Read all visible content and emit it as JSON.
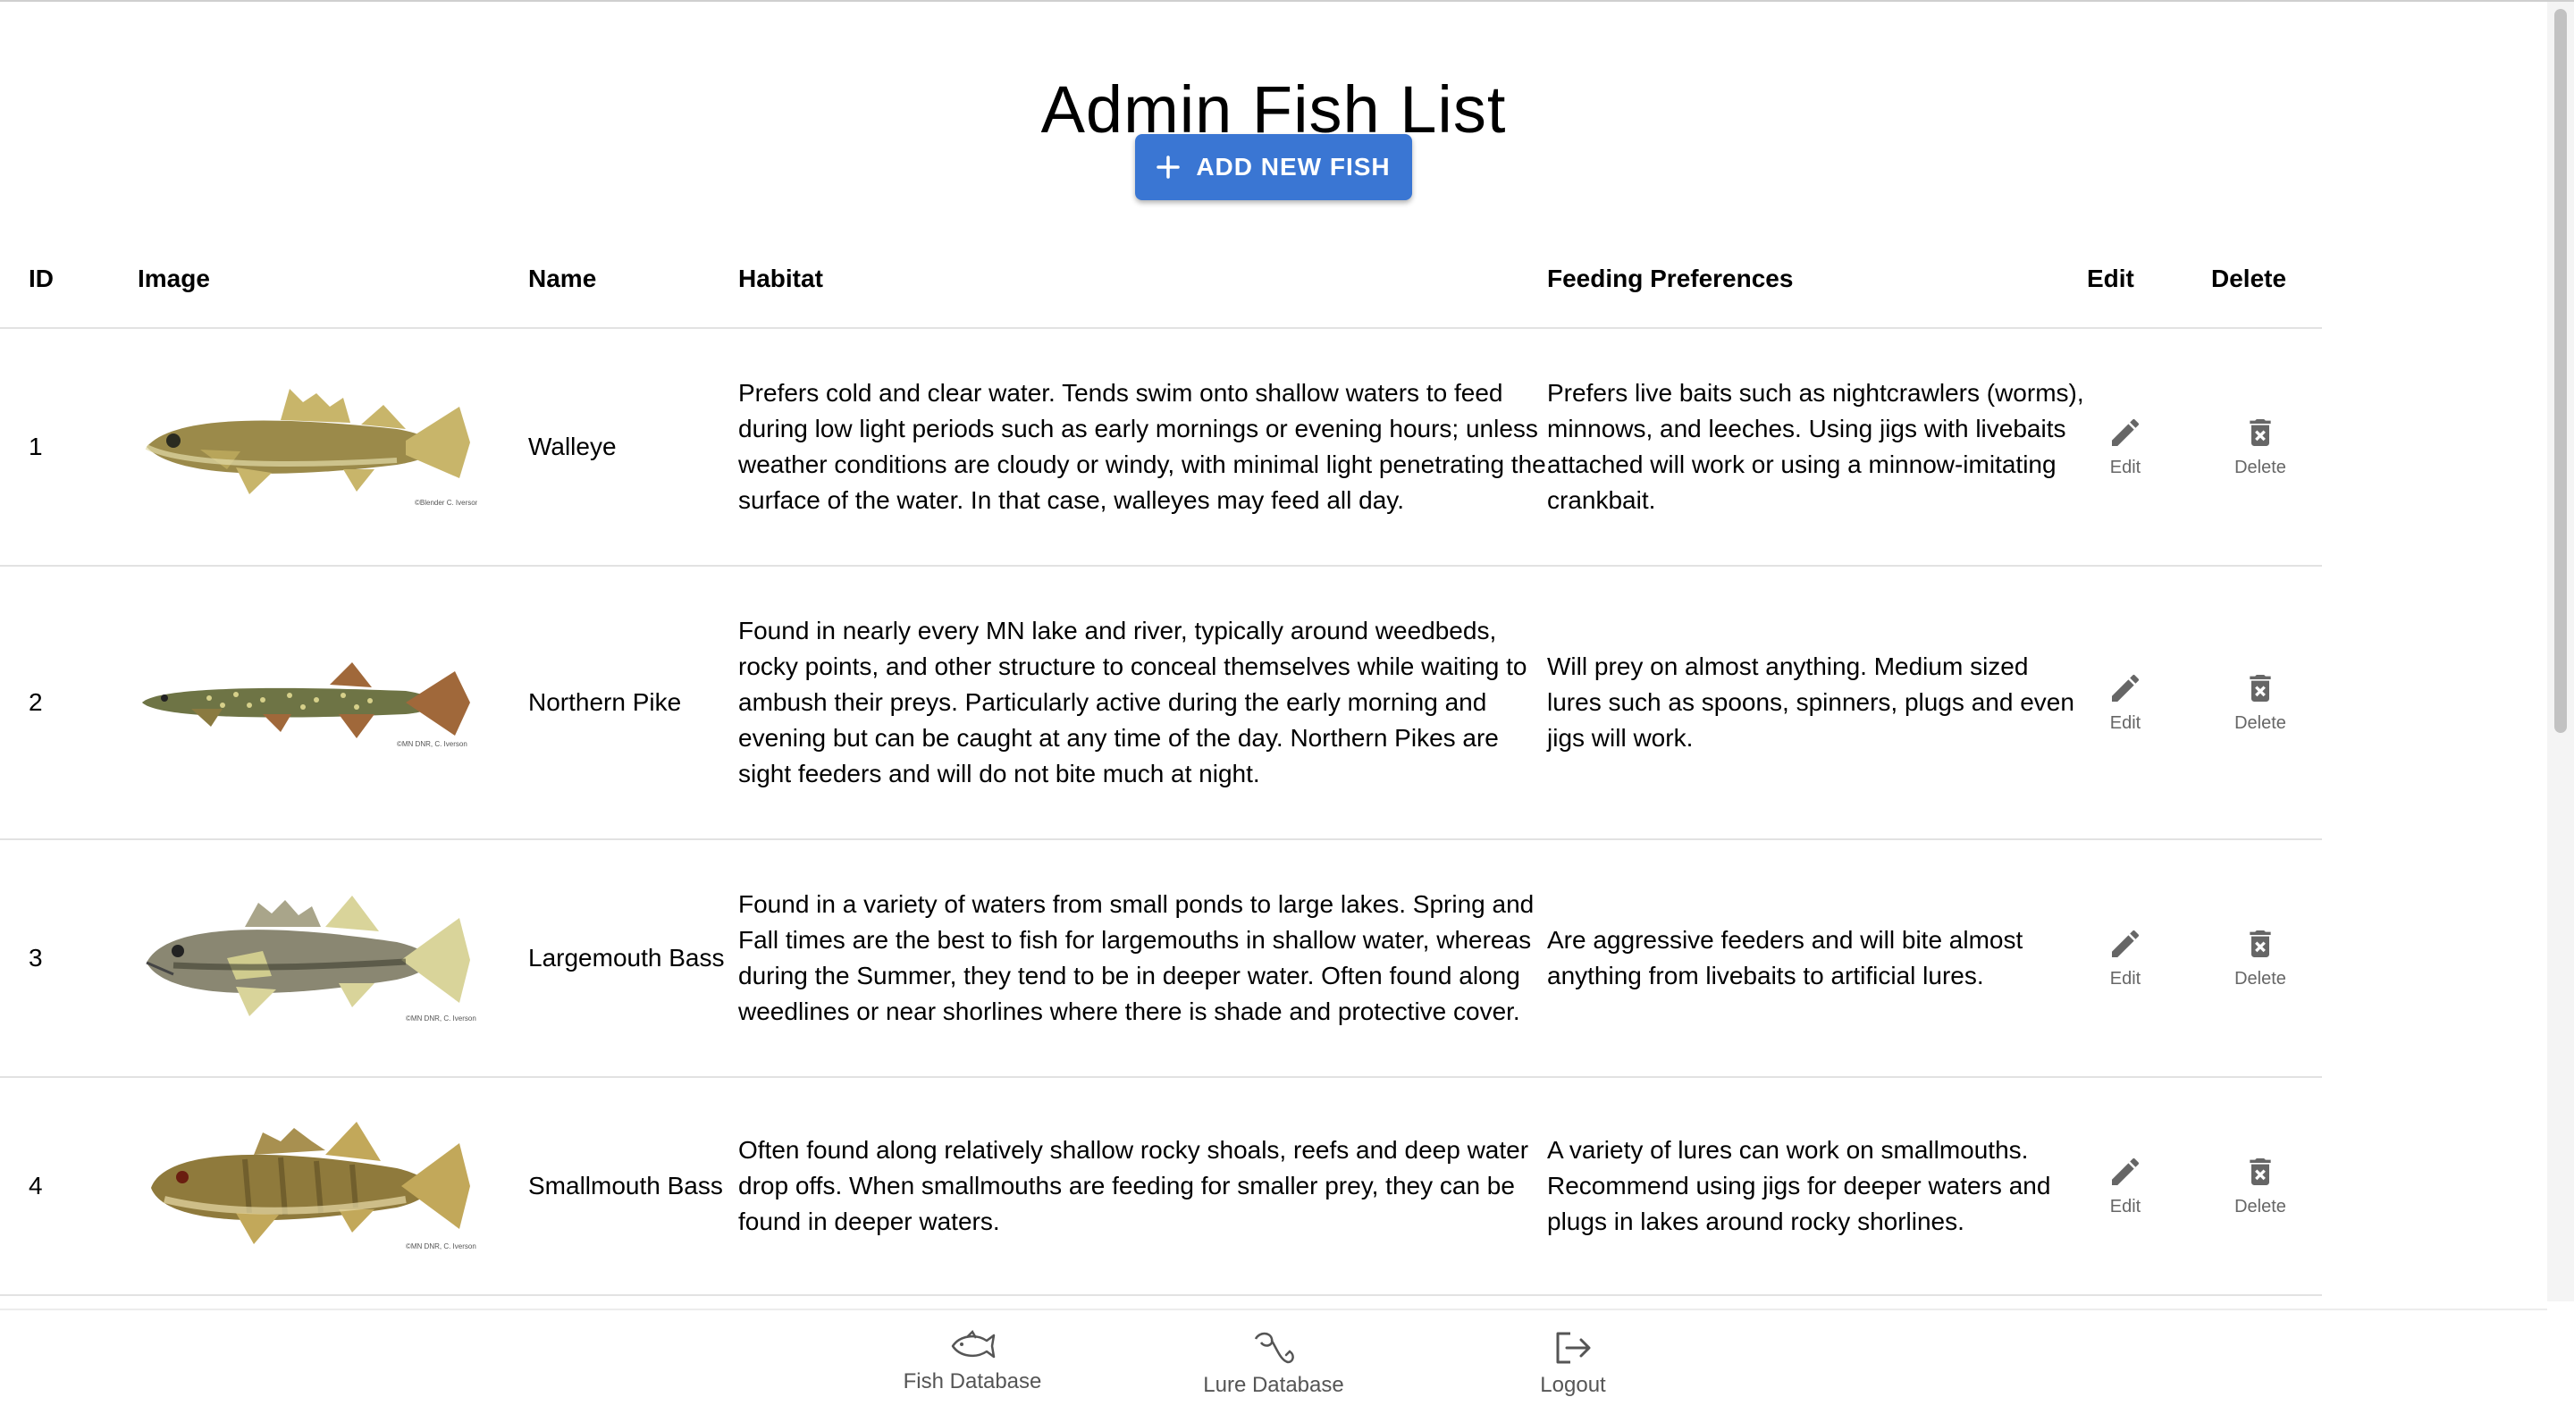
{
  "page": {
    "title": "Admin Fish List"
  },
  "add_button": {
    "label": "ADD NEW FISH"
  },
  "table": {
    "headers": [
      "ID",
      "Image",
      "Name",
      "Habitat",
      "Feeding Preferences",
      "Edit",
      "Delete"
    ],
    "edit_label": "Edit",
    "delete_label": "Delete",
    "rows": [
      {
        "id": "1",
        "name": "Walleye",
        "habitat": "Prefers cold and clear water. Tends swim onto shallow waters to feed during low light periods such as early mornings or evening hours; unless weather conditions are cloudy or windy, with minimal light penetrating the surface of the water. In that case, walleyes may feed all day.",
        "feeding": "Prefers live baits such as nightcrawlers (worms), minnows, and leeches. Using jigs with livebaits attached will work or using a minnow-imitating crankbait.",
        "image": {
          "credit": "©Blender C. Iverson",
          "body_color": "#9b8a4a",
          "fin_color": "#c8b56a"
        }
      },
      {
        "id": "2",
        "name": "Northern Pike",
        "habitat": "Found in nearly every MN lake and river, typically around weedbeds, rocky points, and other structure to conceal themselves while waiting to ambush their preys. Particularly active during the early morning and evening but can be caught at any time of the day. Northern Pikes are sight feeders and will do not bite much at night.",
        "feeding": "Will prey on almost anything. Medium sized lures such as spoons, spinners, plugs and even jigs will work.",
        "image": {
          "credit": "©MN DNR, C. Iverson",
          "body_color": "#6e7445",
          "fin_color": "#a0683a"
        }
      },
      {
        "id": "3",
        "name": "Largemouth Bass",
        "habitat": "Found in a variety of waters from small ponds to large lakes. Spring and Fall times are the best to fish for largemouths in shallow water, whereas during the Summer, they tend to be in deeper water. Often found along weedlines or near shorlines where there is shade and protective cover.",
        "feeding": "Are aggressive feeders and will bite almost anything from livebaits to artificial lures.",
        "image": {
          "credit": "©MN DNR, C. Iverson",
          "body_color": "#8a8772",
          "fin_color": "#d9d49a"
        }
      },
      {
        "id": "4",
        "name": "Smallmouth Bass",
        "habitat": "Often found along relatively shallow rocky shoals, reefs and deep water drop offs. When smallmouths are feeding for smaller prey, they can be found in deeper waters.",
        "feeding": "A variety of lures can work on smallmouths. Recommend using jigs for deeper waters and plugs in lakes around rocky shorlines.",
        "image": {
          "credit": "©MN DNR, C. Iverson",
          "body_color": "#8f7a3c",
          "fin_color": "#c2a85a"
        }
      }
    ]
  },
  "bottom_nav": {
    "items": [
      {
        "label": "Fish Database",
        "icon": "fish-icon"
      },
      {
        "label": "Lure Database",
        "icon": "lure-hook-icon"
      },
      {
        "label": "Logout",
        "icon": "logout-icon"
      }
    ]
  },
  "colors": {
    "accent": "#3a76d3",
    "icon_gray": "#666666"
  }
}
